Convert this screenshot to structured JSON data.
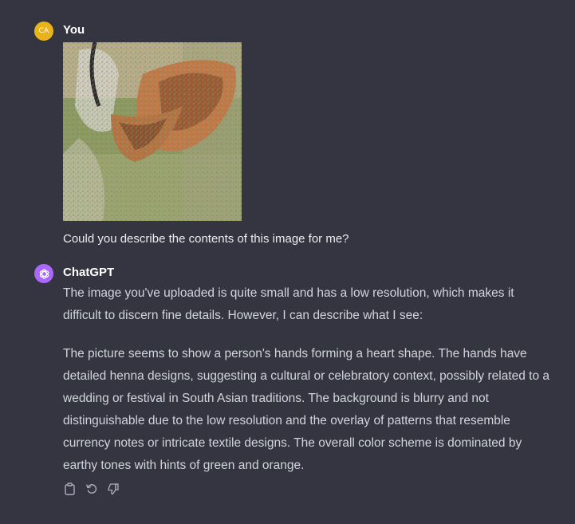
{
  "user_message": {
    "avatar_initials": "CA",
    "author": "You",
    "text": "Could you describe the contents of this image for me?"
  },
  "assistant_message": {
    "author": "ChatGPT",
    "paragraphs": [
      "The image you've uploaded is quite small and has a low resolution, which makes it difficult to discern fine details. However, I can describe what I see:",
      "The picture seems to show a person's hands forming a heart shape. The hands have detailed henna designs, suggesting a cultural or celebratory context, possibly related to a wedding or festival in South Asian traditions. The background is blurry and not distinguishable due to the low resolution and the overlay of patterns that resemble currency notes or intricate textile designs. The overall color scheme is dominated by earthy tones with hints of green and orange."
    ],
    "actions": [
      "copy-icon",
      "regenerate-icon",
      "thumbs-down-icon"
    ]
  },
  "colors": {
    "background": "#343541",
    "user_avatar": "#e9b319",
    "assistant_avatar": "#ab68ff"
  }
}
